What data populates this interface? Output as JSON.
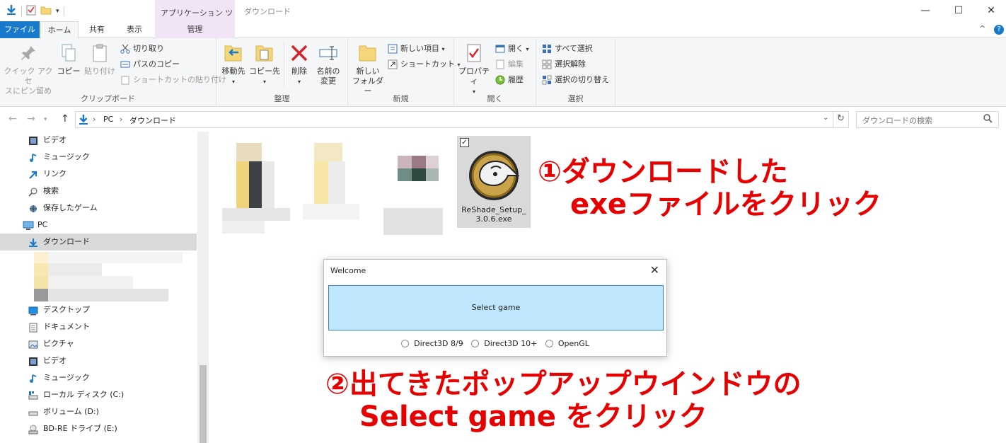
{
  "titlebar": {
    "context_tab_header": "アプリケーション ツール",
    "window_title": "ダウンロード",
    "minimize": "—",
    "maximize": "☐",
    "close": "✕"
  },
  "tabs": {
    "file": "ファイル",
    "home": "ホーム",
    "share": "共有",
    "view": "表示",
    "manage": "管理"
  },
  "ribbon": {
    "clipboard": {
      "label": "クリップボード",
      "pin_line1": "クイック アクセ",
      "pin_line2": "スにピン留め",
      "copy": "コピー",
      "paste": "貼り付け",
      "cut": "切り取り",
      "copy_path": "パスのコピー",
      "paste_shortcut": "ショートカットの貼り付け"
    },
    "organize": {
      "label": "整理",
      "move_to": "移動先",
      "copy_to": "コピー先",
      "delete": "削除",
      "rename_line1": "名前の",
      "rename_line2": "変更"
    },
    "new": {
      "label": "新規",
      "new_folder_line1": "新しい",
      "new_folder_line2": "フォルダー",
      "new_item": "新しい項目",
      "easy_access": "ショートカット"
    },
    "open": {
      "label": "開く",
      "properties": "プロパティ",
      "open": "開く",
      "edit": "編集",
      "history": "履歴"
    },
    "select": {
      "label": "選択",
      "select_all": "すべて選択",
      "select_none": "選択解除",
      "invert": "選択の切り替え"
    }
  },
  "address": {
    "path_root": "PC",
    "path_current": "ダウンロード",
    "search_placeholder": "ダウンロードの検索"
  },
  "nav": {
    "videos1": "ビデオ",
    "music1": "ミュージック",
    "links": "リンク",
    "search": "検索",
    "saved_games": "保存したゲーム",
    "pc": "PC",
    "downloads": "ダウンロード",
    "desktop": "デスクトップ",
    "documents": "ドキュメント",
    "pictures": "ピクチャ",
    "videos2": "ビデオ",
    "music2": "ミュージック",
    "local_disk": "ローカル ディスク (C:)",
    "volume_d": "ボリューム (D:)",
    "bdre": "BD-RE ドライブ (E:)"
  },
  "files": {
    "reshade_name": "ReShade_Setup_3.0.6.exe",
    "reshade_checked": "✓"
  },
  "annotations": {
    "step1_line1": "①ダウンロードした",
    "step1_line2": "exeファイルをクリック",
    "step2_line1": "②出てきたポップアップウインドウの",
    "step2_line2": "Select game をクリック"
  },
  "dialog": {
    "title": "Welcome",
    "close": "✕",
    "select_game": "Select game",
    "radio_d3d9": "Direct3D 8/9",
    "radio_d3d10": "Direct3D 10+",
    "radio_opengl": "OpenGL"
  },
  "colors": {
    "accent": "#1979ca",
    "annotation": "#e60000",
    "select_game_bg": "#bee6fd",
    "context_tab": "#f1e4f7"
  }
}
